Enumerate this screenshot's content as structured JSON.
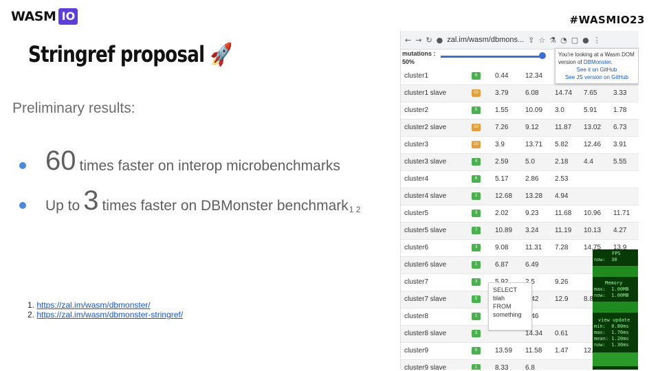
{
  "header": {
    "logo_text": "WASM",
    "logo_badge": "IO",
    "hashtag": "#WASMIO23"
  },
  "slide": {
    "title": "Stringref proposal",
    "title_emoji": "🚀",
    "subtitle": "Preliminary results:",
    "bullets": [
      {
        "big": "60",
        "text": "times faster on interop microbenchmarks",
        "sup": ""
      },
      {
        "prefix": "Up to",
        "big": "3",
        "text": "times faster on DBMonster benchmark",
        "sup": "1 2"
      }
    ],
    "footnotes": [
      "https://zal.im/wasm/dbmonster/",
      "https://zal.im/wasm/dbmonster-stringref/"
    ]
  },
  "browser": {
    "url": "zal.im/wasm/dbmons...",
    "mutations_label": "mutations :",
    "mutations_value": "50%",
    "mutations_fraction": 0.95,
    "popup": {
      "line1": "You're looking at a Wasm DOM",
      "line2_prefix": "version of",
      "line2_link": "DBMonster",
      "link_github": "See it on GitHub",
      "link_js": "See JS version on GitHub"
    },
    "rows": [
      {
        "name": "cluster1",
        "count": "6",
        "color": "#4caf50",
        "cells": [
          "0.44",
          "12.34",
          "",
          "",
          ""
        ]
      },
      {
        "name": "cluster1 slave",
        "count": "10",
        "color": "#e0a040",
        "cells": [
          "3.79",
          "6.08",
          "14.74",
          "7.65",
          "3.33"
        ]
      },
      {
        "name": "cluster2",
        "count": "5",
        "color": "#4caf50",
        "cells": [
          "1.55",
          "10.09",
          "3.0",
          "5.91",
          "1.78"
        ]
      },
      {
        "name": "cluster2 slave",
        "count": "10",
        "color": "#e0a040",
        "cells": [
          "7.26",
          "9.12",
          "11.87",
          "13.02",
          "6.73"
        ]
      },
      {
        "name": "cluster3",
        "count": "10",
        "color": "#e0a040",
        "cells": [
          "3.9",
          "13.71",
          "5.82",
          "12.46",
          "3.91"
        ]
      },
      {
        "name": "cluster3 slave",
        "count": "4",
        "color": "#4caf50",
        "cells": [
          "2.59",
          "5.0",
          "2.18",
          "4.4",
          "5.55"
        ]
      },
      {
        "name": "cluster4",
        "count": "6",
        "color": "#4caf50",
        "cells": [
          "5.17",
          "2.86",
          "2.53",
          "",
          ""
        ]
      },
      {
        "name": "cluster4 slave",
        "count": "2",
        "color": "#4caf50",
        "cells": [
          "12.68",
          "13.28",
          "4.94",
          "",
          ""
        ]
      },
      {
        "name": "cluster5",
        "count": "3",
        "color": "#4caf50",
        "cells": [
          "2.02",
          "9.23",
          "11.68",
          "10.96",
          "11.71"
        ]
      },
      {
        "name": "cluster5 slave",
        "count": "7",
        "color": "#4caf50",
        "cells": [
          "10.89",
          "3.24",
          "11.19",
          "10.13",
          "4.27"
        ]
      },
      {
        "name": "cluster6",
        "count": "3",
        "color": "#4caf50",
        "cells": [
          "9.08",
          "11.31",
          "7.28",
          "14.75",
          "13.9"
        ]
      },
      {
        "name": "cluster6 slave",
        "count": "1",
        "color": "#4caf50",
        "cells": [
          "6.87",
          "6.49",
          "",
          "",
          ""
        ]
      },
      {
        "name": "cluster7",
        "count": "3",
        "color": "#4caf50",
        "cells": [
          "5.92",
          "2.5",
          "9.26",
          "",
          ""
        ]
      },
      {
        "name": "cluster7 slave",
        "count": "5",
        "color": "#4caf50",
        "cells": [
          "",
          "5.42",
          "12.9",
          "8.8",
          ""
        ]
      },
      {
        "name": "cluster8",
        "count": "1",
        "color": "#4caf50",
        "cells": [
          "",
          "4.46",
          "",
          "",
          ""
        ]
      },
      {
        "name": "cluster8 slave",
        "count": "3",
        "color": "#4caf50",
        "cells": [
          "",
          "14.34",
          "0.61",
          "",
          ""
        ]
      },
      {
        "name": "cluster9",
        "count": "5",
        "color": "#4caf50",
        "cells": [
          "13.59",
          "11.58",
          "1.47",
          "12.",
          ""
        ]
      },
      {
        "name": "cluster9 slave",
        "count": "1",
        "color": "#4caf50",
        "cells": [
          "8.33",
          "6.8",
          "",
          "",
          ""
        ]
      }
    ],
    "sql_popup": [
      "SELECT",
      "blah",
      "FROM",
      "something"
    ],
    "monitor": {
      "fps_title": "FPS",
      "fps_now": "now:  30",
      "memory_title": "Memory",
      "memory_max": "max:  1.00MB",
      "memory_now": "now:  1.00MB",
      "view_title": "view update",
      "view_min": "min:  0.80ms",
      "view_max": "max:  1.70ms",
      "view_mean": "mean: 1.20ms",
      "view_now": "now:  1.30ms"
    }
  }
}
